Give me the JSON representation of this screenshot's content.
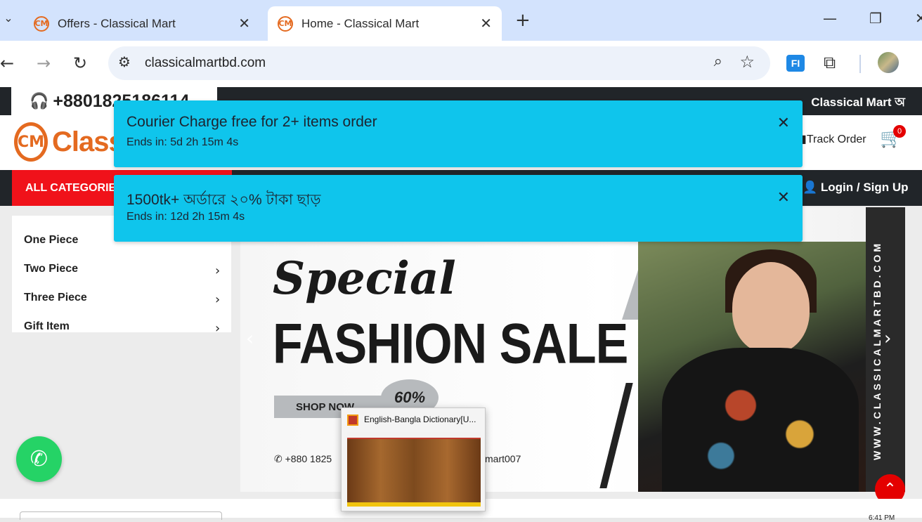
{
  "browser": {
    "tabs": [
      {
        "title": "Offers - Classical Mart",
        "favicon": "classical-mart-logo"
      },
      {
        "title": "Home - Classical Mart",
        "favicon": "classical-mart-logo"
      }
    ],
    "url": "classicalmartbd.com",
    "extension_label": "FI"
  },
  "site": {
    "phone": "+8801825186114",
    "marquee": "Classical Mart অ",
    "logo_text": "Classic",
    "track_order": "Track Order",
    "cart_count": "0",
    "all_categories": "ALL CATEGORIES",
    "login": "Login / Sign Up",
    "categories": [
      {
        "label": "One Piece",
        "has_sub": false
      },
      {
        "label": "Two Piece",
        "has_sub": true
      },
      {
        "label": "Three Piece",
        "has_sub": true
      },
      {
        "label": "Gift Item",
        "has_sub": true
      }
    ],
    "banner": {
      "special": "Special",
      "headline": "FASHION SALE",
      "shop_now": "SHOP NOW",
      "discount": "60%",
      "phone": "+880 1825",
      "handle": "mart007",
      "side_text": "WWW.CLASSICALMARTBD.COM"
    }
  },
  "toasts": [
    {
      "title": "Courier Charge free for 2+ items order",
      "subtitle": "Ends in: 5d 2h 15m 4s"
    },
    {
      "title": "1500tk+ অর্ডারে ২০% টাকা ছাড়",
      "subtitle": "Ends in: 12d 2h 15m 4s"
    }
  ],
  "thumbnail": {
    "title": "English-Bangla Dictionary[U..."
  },
  "taskbar": {
    "time": "6:41 PM"
  },
  "colors": {
    "toast": "#0fc5ec",
    "accent_red": "#f0121a",
    "brand_orange": "#e46a20",
    "whatsapp": "#25d366"
  }
}
